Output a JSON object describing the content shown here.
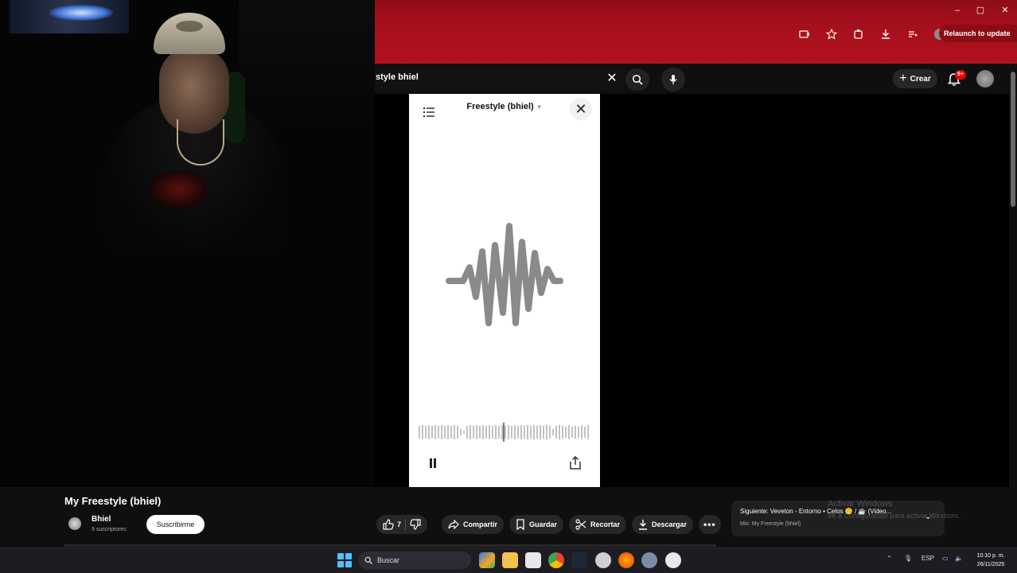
{
  "window": {
    "minimize": "–",
    "maximize": "▢",
    "close": "✕",
    "relaunch_label": "Relaunch to update"
  },
  "yt_header": {
    "search_value": "style bhiel",
    "create_label": "Crear",
    "notification_badge": "9+"
  },
  "player": {
    "title": "Freestyle (bhiel)"
  },
  "video": {
    "title": "My Freestyle (bhiel)",
    "channel_name": "Bhiel",
    "subscribers": "9 suscriptores",
    "subscribe_label": "Suscribirme",
    "like_count": "7",
    "share_label": "Compartir",
    "save_label": "Guardar",
    "clip_label": "Recortar",
    "download_label": "Descargar"
  },
  "up_next": {
    "title": "Siguiente: Veveton - Entorno • Celos 🙃 / ☕ (Video...",
    "subtitle": "Mix: My Freestyle (bhiel)"
  },
  "watermark": {
    "line1": "Activar Windows",
    "line2": "Ve a Configuración para activar Windows."
  },
  "taskbar": {
    "search_placeholder": "Buscar",
    "language": "ESP",
    "time": "10:10 p. m.",
    "date": "26/11/2025"
  },
  "colors": {
    "chrome_red": "#a50f1c",
    "yt_dark": "#0f0f0f",
    "wave_gray": "#8a8a8a",
    "windows_accent": "#4cc2ff"
  }
}
